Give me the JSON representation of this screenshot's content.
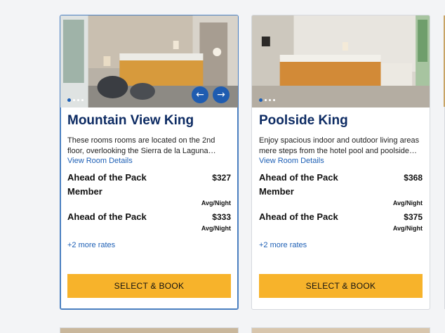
{
  "cards": [
    {
      "title": "Mountain View King",
      "description": "These rooms rooms are located on the 2nd floor, overlooking the Sierra de la Laguna…",
      "details_link": "View Room Details",
      "rates": [
        {
          "name": "Ahead of the Pack Member",
          "price": "$327",
          "unit": "Avg/Night"
        },
        {
          "name": "Ahead of the Pack",
          "price": "$333",
          "unit": "Avg/Night"
        }
      ],
      "more_rates": "+2 more rates",
      "book_label": "SELECT & BOOK",
      "prev_icon": "arrow-left-icon",
      "next_icon": "arrow-right-icon"
    },
    {
      "title": "Poolside King",
      "description": "Enjoy spacious indoor and outdoor living areas mere steps from the hotel pool and poolside…",
      "details_link": "View Room Details",
      "rates": [
        {
          "name": "Ahead of the Pack Member",
          "price": "$368",
          "unit": "Avg/Night"
        },
        {
          "name": "Ahead of the Pack",
          "price": "$375",
          "unit": "Avg/Night"
        }
      ],
      "more_rates": "+2 more rates",
      "book_label": "SELECT & BOOK"
    }
  ],
  "colors": {
    "title": "#0d2b63",
    "link": "#1d5fb5",
    "book_button": "#f7b32b",
    "arrow": "#1f5cb0",
    "selected_border": "#4a7fc0"
  }
}
